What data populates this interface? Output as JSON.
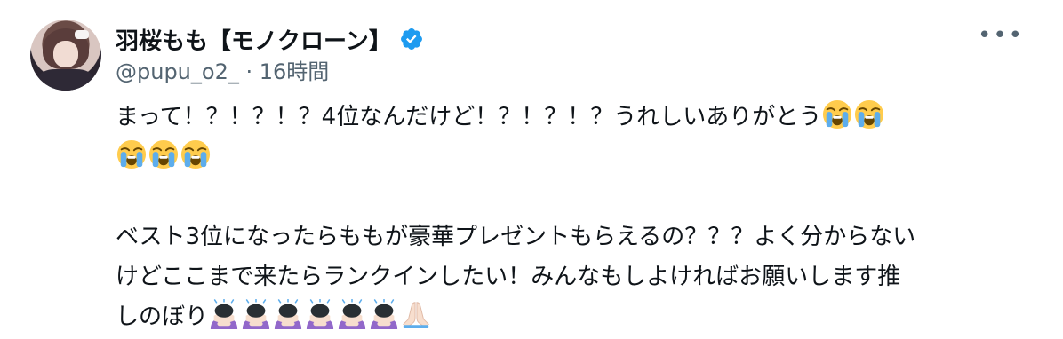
{
  "author": {
    "display_name": "羽桜もも【モノクローン】",
    "handle": "@pupu_o2_",
    "separator": "·",
    "time": "16時間",
    "verified_color": "#1d9bf0"
  },
  "post": {
    "line1_text": "まって！？！？！？4位なんだけど！？！？！？うれしいありがとう",
    "paragraph2_line1": "ベスト3位になったらももが豪華プレゼントもらえるの？？？よく分からない",
    "paragraph2_line2": "けどここまで来たらランクインしたい！みんなもしよければお願いします推",
    "paragraph2_line3": "しのぼり"
  },
  "menu": {
    "more_label": "•••"
  },
  "icons": {
    "verified": "verified-badge-icon",
    "more": "more-options-icon",
    "crying": "loudly-crying-face-emoji",
    "bowing": "woman-bowing-emoji",
    "praying": "folded-hands-emoji"
  }
}
